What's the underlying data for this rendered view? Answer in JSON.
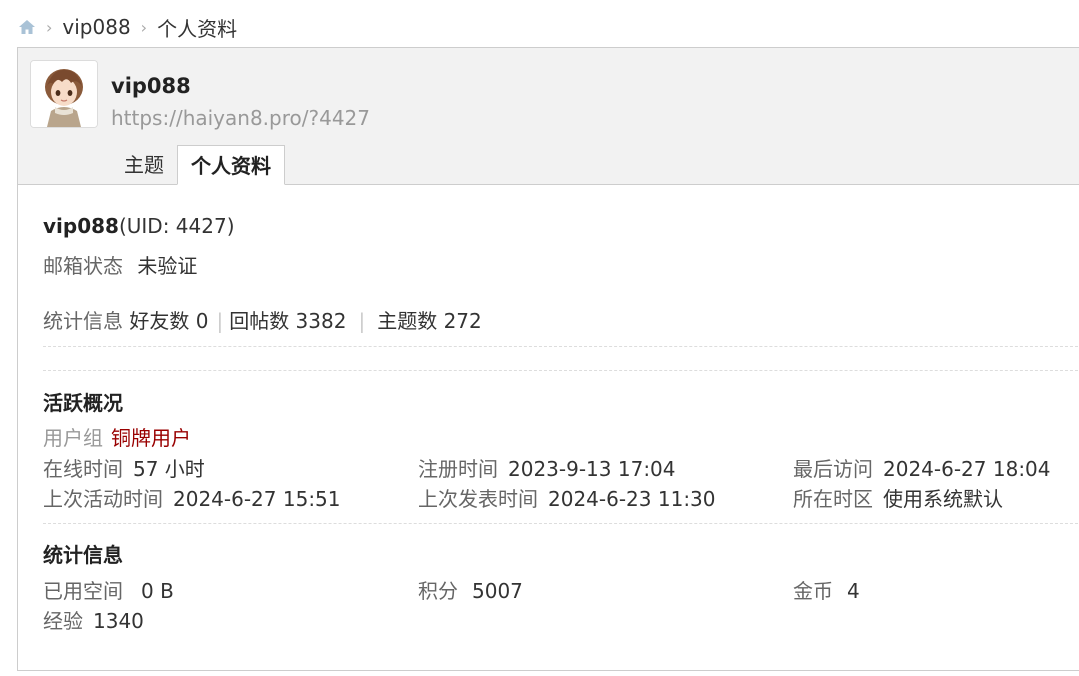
{
  "breadcrumb": {
    "home_icon": "home-icon",
    "items": [
      "vip088",
      "个人资料"
    ]
  },
  "profile": {
    "username": "vip088",
    "url": "https://haiyan8.pro/?4427",
    "tabs": [
      {
        "label": "主题",
        "active": false
      },
      {
        "label": "个人资料",
        "active": true
      }
    ]
  },
  "details": {
    "name": "vip088",
    "uid_text": "(UID: 4427)",
    "email_label": "邮箱状态",
    "email_value": "未验证",
    "stats_label": "统计信息",
    "friends": "好友数 0",
    "replies": "回帖数 3382",
    "topics": "主题数 272"
  },
  "activity": {
    "title": "活跃概况",
    "group_label": "用户组",
    "group_value": "铜牌用户",
    "online_label": "在线时间",
    "online_value": "57 小时",
    "reg_label": "注册时间",
    "reg_value": "2023-9-13 17:04",
    "last_visit_label": "最后访问",
    "last_visit_value": "2024-6-27 18:04",
    "last_active_label": "上次活动时间",
    "last_active_value": "2024-6-27 15:51",
    "last_post_label": "上次发表时间",
    "last_post_value": "2024-6-23 11:30",
    "tz_label": "所在时区",
    "tz_value": "使用系统默认"
  },
  "statistics": {
    "title": "统计信息",
    "space_label": "已用空间",
    "space_value": "0 B",
    "points_label": "积分",
    "points_value": "5007",
    "coins_label": "金币",
    "coins_value": "4",
    "exp_label": "经验",
    "exp_value": "1340"
  },
  "colors": {
    "group_value": "#990000",
    "muted": "#666666",
    "url": "#999999",
    "header_bg": "#f2f2f2"
  }
}
